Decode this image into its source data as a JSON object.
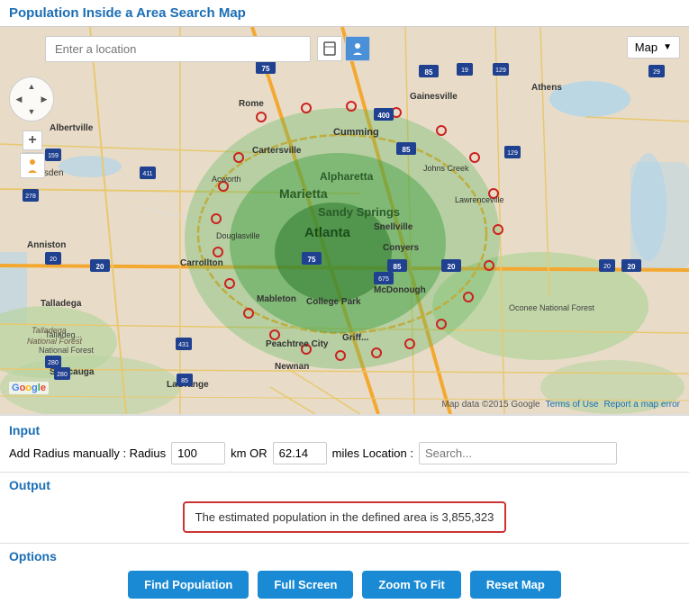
{
  "page": {
    "title": "Population Inside a Area Search Map"
  },
  "map": {
    "search_placeholder": "Enter a location",
    "type_label": "Map",
    "type_dropdown_arrow": "▼",
    "attribution": "Map data ©2015 Google",
    "terms_link": "Terms of Use",
    "report_link": "Report a map error"
  },
  "input": {
    "section_label": "Input",
    "radius_label_prefix": "Add Radius manually : Radius",
    "radius_value": "100",
    "unit_km": "km OR",
    "miles_value": "62.14",
    "unit_miles": "miles Location :",
    "location_search_placeholder": "Search..."
  },
  "output": {
    "section_label": "Output",
    "result_text": "The estimated population in the defined area is 3,855,323"
  },
  "options": {
    "section_label": "Options",
    "btn_find": "Find Population",
    "btn_fullscreen": "Full Screen",
    "btn_zoom": "Zoom To Fit",
    "btn_reset": "Reset Map"
  }
}
